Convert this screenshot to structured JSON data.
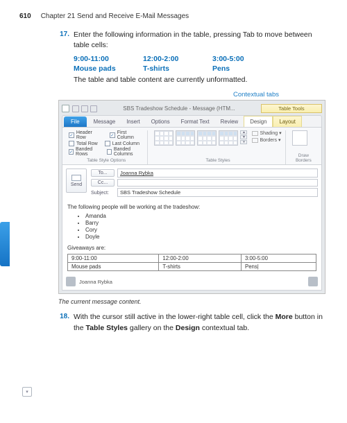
{
  "header": {
    "pageNumber": "610",
    "chapterTitle": "Chapter 21   Send and Receive E-Mail Messages"
  },
  "step17": {
    "num": "17.",
    "text": "Enter the following information in the table, pressing Tab to move between table cells:",
    "row1": {
      "a": "9:00-11:00",
      "b": "12:00-2:00",
      "c": "3:00-5:00"
    },
    "row2": {
      "a": "Mouse pads",
      "b": "T-shirts",
      "c": "Pens"
    },
    "note": "The table and table content are currently unformatted."
  },
  "ctxLabel": "Contextual tabs",
  "outlook": {
    "windowTitle": "SBS Tradeshow Schedule - Message (HTM...",
    "ctxGroup": "Table Tools",
    "tabs": {
      "file": "File",
      "message": "Message",
      "insert": "Insert",
      "options": "Options",
      "formatText": "Format Text",
      "review": "Review",
      "design": "Design",
      "layout": "Layout"
    },
    "checks": {
      "headerRow": "Header Row",
      "firstColumn": "First Column",
      "totalRow": "Total Row",
      "lastColumn": "Last Column",
      "bandedRows": "Banded Rows",
      "bandedCols": "Banded Columns"
    },
    "groupLabels": {
      "tso": "Table Style Options",
      "ts": "Table Styles",
      "db": "Draw Borders"
    },
    "side": {
      "shading": "Shading",
      "borders": "Borders"
    },
    "fields": {
      "to": "To...",
      "cc": "Cc...",
      "subject": "Subject:",
      "send": "Send",
      "toValue": "Joanna Rybka",
      "subjectValue": "SBS Tradeshow Schedule"
    },
    "body": {
      "intro": "The following people will be working at the tradeshow:",
      "people": [
        "Amanda",
        "Barry",
        "Cory",
        "Doyle"
      ],
      "giveaways": "Giveaways are:"
    },
    "table": {
      "r1": [
        "9:00-11:00",
        "12:00-2:00",
        "3:00-5:00"
      ],
      "r2": [
        "Mouse pads",
        "T-shirts",
        "Pens|"
      ]
    },
    "status": {
      "name": "Joanna Rybka"
    }
  },
  "caption": "The current message content.",
  "step18": {
    "num": "18.",
    "textA": "With the cursor still active in the lower-right table cell, click the ",
    "more": "More",
    "textB": " button in the ",
    "tsg": "Table Styles",
    "textC": " gallery on the ",
    "design": "Design",
    "textD": " contextual tab."
  }
}
